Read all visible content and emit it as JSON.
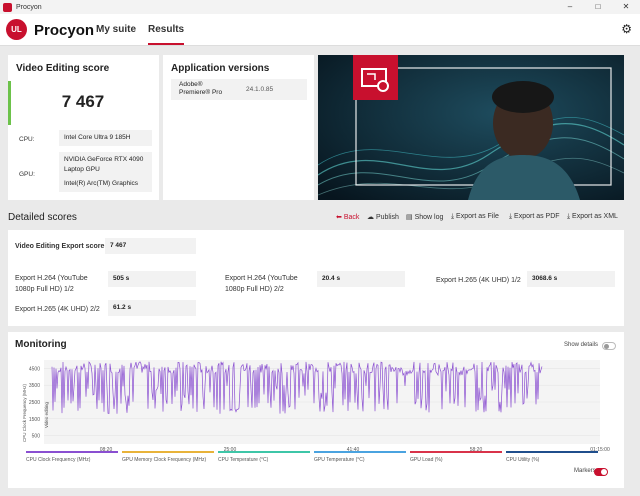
{
  "window": {
    "title": "Procyon",
    "controls": [
      "–",
      "□",
      "✕"
    ]
  },
  "nav": {
    "logo_text": "UL",
    "brand": "Procyon",
    "tabs": [
      {
        "label": "My suite"
      },
      {
        "label": "Results"
      }
    ]
  },
  "score_card": {
    "title": "Video Editing score",
    "score": "7 467",
    "cpu_label": "CPU:",
    "cpu_value": "Intel Core Ultra 9 185H",
    "gpu_label": "GPU:",
    "gpu_value_1": "NVIDIA GeForce RTX 4090 Laptop GPU",
    "gpu_value_2": "Intel(R) Arc(TM) Graphics",
    "accent": "#6cc24a"
  },
  "app_versions": {
    "title": "Application versions",
    "app_name": "Adobe® Premiere® Pro",
    "app_version": "24.1.0.85"
  },
  "detailed": {
    "title": "Detailed scores",
    "actions": {
      "back": "Back",
      "publish": "Publish",
      "show_log": "Show log",
      "export_file": "Export as File",
      "export_pdf": "Export as PDF",
      "export_xml": "Export as XML"
    },
    "export_score_label": "Video Editing Export score",
    "export_score_value": "7 467",
    "items": [
      {
        "label": "Export H.264 (YouTube 1080p Full HD) 1/2",
        "value": "505 s"
      },
      {
        "label": "Export H.264 (YouTube 1080p Full HD) 2/2",
        "value": "20.4 s"
      },
      {
        "label": "Export H.265 (4K UHD) 1/2",
        "value": "3068.6 s"
      },
      {
        "label": "Export H.265 (4K UHD) 2/2",
        "value": "61.2 s"
      }
    ]
  },
  "monitoring": {
    "title": "Monitoring",
    "show_details": "Show details",
    "markers": "Markers",
    "y_axis_label": "CPU Clock Frequency (MHz)",
    "marker_label": "Video editing",
    "y_ticks": [
      "4500",
      "3500",
      "2500",
      "1500",
      "500"
    ],
    "x_ticks": [
      "08:20",
      "25:00",
      "41:40",
      "58:20",
      "01:15:00"
    ],
    "legend": [
      {
        "label": "CPU Clock Frequency (MHz)",
        "color": "#8a4fd1"
      },
      {
        "label": "GPU Memory Clock Frequency (MHz)",
        "color": "#e8b33a"
      },
      {
        "label": "CPU Temperature (°C)",
        "color": "#3ec6a8"
      },
      {
        "label": "GPU Temperature (°C)",
        "color": "#4aa3e0"
      },
      {
        "label": "GPU Load (%)",
        "color": "#d9334a"
      },
      {
        "label": "CPU Utility (%)",
        "color": "#1f4e8c"
      }
    ]
  },
  "colors": {
    "brand_red": "#c8102e",
    "trace": "#8a4fd1"
  }
}
